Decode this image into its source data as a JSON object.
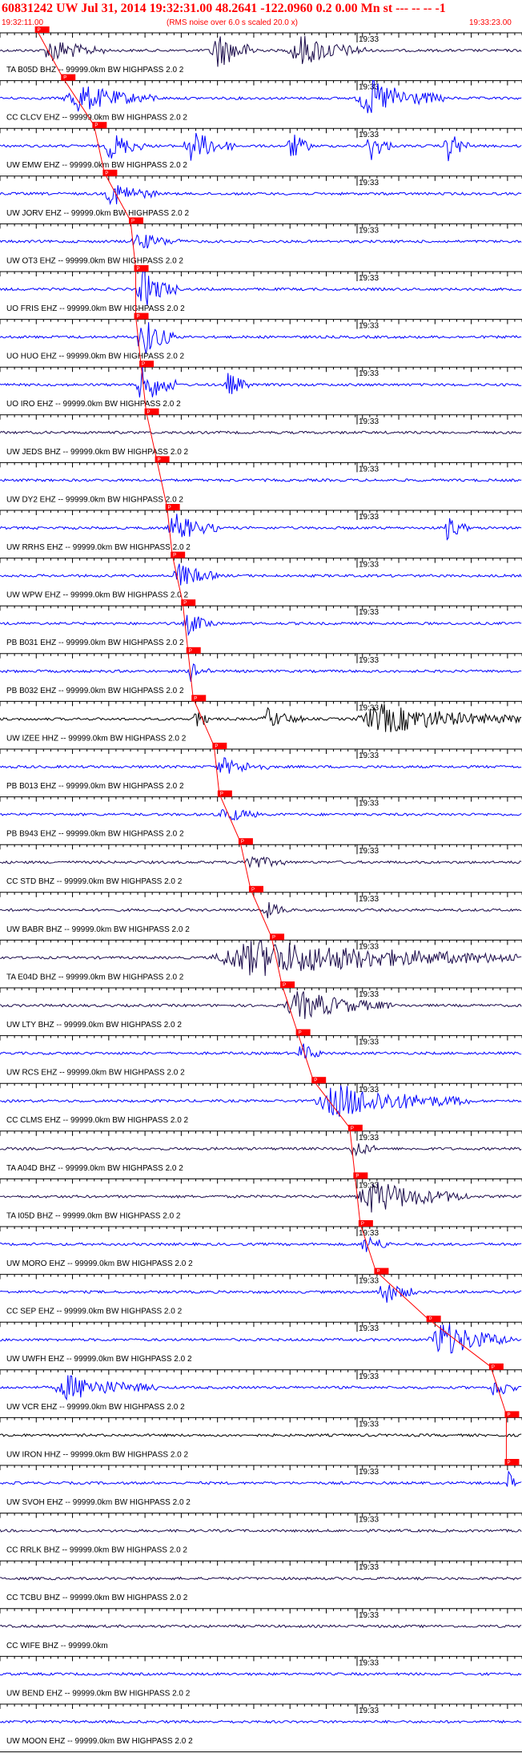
{
  "header": {
    "title": "60831242 UW Jul 31, 2014 19:32:31.00   48.2641 -122.0960  0.2 0.00 Mn st --- -- --   -1",
    "start_time": "19:32:11.00",
    "note": "(RMS noise over 6.0 s scaled 20.0 x)",
    "end_time": "19:33:23.00"
  },
  "time_mark_label": "19:33",
  "colors": {
    "header_text": "#ff0000",
    "blue_trace": "#0000ff",
    "dark_trace": "#1a0a4a",
    "black_trace": "#000000",
    "pick_box": "#ff0000",
    "pick_line": "#ff0000"
  },
  "chart_data": {
    "type": "line",
    "title": "60831242 UW Jul 31, 2014 19:32:31.00",
    "x_range": [
      "19:32:11.00",
      "19:33:23.00"
    ],
    "x_major_label": "19:33",
    "traces": [
      {
        "label": "TA B05D BHZ -- 99999.0km BW  HIGHPASS  2.0  2",
        "color": "#1a0a4a",
        "pick": 0.07,
        "activity": [
          [
            0.08,
            0.2,
            0.6
          ],
          [
            0.4,
            0.5,
            0.9
          ],
          [
            0.55,
            0.7,
            0.8
          ]
        ]
      },
      {
        "label": "CC CLCV EHZ -- 99999.0km BW  HIGHPASS  2.0  2",
        "color": "#0000ff",
        "pick": 0.12,
        "activity": [
          [
            0.12,
            0.3,
            0.7
          ],
          [
            0.68,
            0.85,
            0.9
          ]
        ]
      },
      {
        "label": "UW EMW EHZ -- 99999.0km BW  HIGHPASS  2.0  2",
        "color": "#0000ff",
        "pick": 0.18,
        "activity": [
          [
            0.2,
            0.28,
            0.7
          ],
          [
            0.35,
            0.45,
            0.8
          ],
          [
            0.55,
            0.6,
            0.7
          ],
          [
            0.7,
            0.75,
            0.8
          ],
          [
            0.85,
            0.9,
            0.8
          ]
        ]
      },
      {
        "label": "UW JORV EHZ -- 99999.0km BW  HIGHPASS  2.0  2",
        "color": "#0000ff",
        "pick": 0.2,
        "activity": [
          [
            0.2,
            0.3,
            0.6
          ]
        ]
      },
      {
        "label": "UW OT3 EHZ -- 99999.0km BW  HIGHPASS  2.0  2",
        "color": "#0000ff",
        "pick": 0.25,
        "activity": [
          [
            0.25,
            0.35,
            0.4
          ]
        ]
      },
      {
        "label": "UO FRIS EHZ -- 99999.0km BW  HIGHPASS  2.0  2",
        "color": "#0000ff",
        "pick": 0.26,
        "activity": [
          [
            0.26,
            0.34,
            1.0
          ]
        ]
      },
      {
        "label": "UO HUO EHZ -- 99999.0km BW  HIGHPASS  2.0  2",
        "color": "#0000ff",
        "pick": 0.26,
        "activity": [
          [
            0.26,
            0.34,
            1.0
          ]
        ]
      },
      {
        "label": "UO IRO EHZ -- 99999.0km BW  HIGHPASS  2.0  2",
        "color": "#0000ff",
        "pick": 0.27,
        "activity": [
          [
            0.26,
            0.34,
            1.0
          ],
          [
            0.43,
            0.48,
            0.6
          ]
        ]
      },
      {
        "label": "UW JEDS BHZ -- 99999.0km BW  HIGHPASS  2.0  2",
        "color": "#1a0a4a",
        "pick": 0.28,
        "activity": []
      },
      {
        "label": "UW DY2 EHZ -- 99999.0km BW  HIGHPASS  2.0  2",
        "color": "#0000ff",
        "pick": 0.3,
        "activity": []
      },
      {
        "label": "UW RRHS EHZ -- 99999.0km BW  HIGHPASS  2.0  2",
        "color": "#0000ff",
        "pick": 0.32,
        "activity": [
          [
            0.32,
            0.42,
            0.7
          ],
          [
            0.85,
            0.9,
            0.6
          ]
        ]
      },
      {
        "label": "UW WPW EHZ -- 99999.0km BW  HIGHPASS  2.0  2",
        "color": "#0000ff",
        "pick": 0.33,
        "activity": [
          [
            0.33,
            0.42,
            0.6
          ]
        ]
      },
      {
        "label": "PB B031 EHZ -- 99999.0km BW  HIGHPASS  2.0  2",
        "color": "#0000ff",
        "pick": 0.35,
        "activity": [
          [
            0.35,
            0.42,
            0.5
          ]
        ]
      },
      {
        "label": "PB B032 EHZ -- 99999.0km BW  HIGHPASS  2.0  2",
        "color": "#0000ff",
        "pick": 0.36,
        "activity": [
          [
            0.36,
            0.4,
            0.5
          ]
        ]
      },
      {
        "label": "UW IZEE HHZ -- 99999.0km BW  HIGHPASS  2.0  2",
        "color": "#000000",
        "pick": 0.37,
        "activity": [
          [
            0.37,
            0.4,
            0.7
          ],
          [
            0.5,
            0.58,
            0.5
          ],
          [
            0.68,
            1.0,
            0.7
          ]
        ]
      },
      {
        "label": "PB B013 EHZ -- 99999.0km BW  HIGHPASS  2.0  2",
        "color": "#0000ff",
        "pick": 0.41,
        "activity": [
          [
            0.41,
            0.52,
            0.4
          ]
        ]
      },
      {
        "label": "PB B943 EHZ -- 99999.0km BW  HIGHPASS  2.0  2",
        "color": "#0000ff",
        "pick": 0.42,
        "activity": [
          [
            0.42,
            0.5,
            0.4
          ]
        ]
      },
      {
        "label": "CC STD BHZ -- 99999.0km BW  HIGHPASS  2.0  2",
        "color": "#1a0a4a",
        "pick": 0.46,
        "activity": [
          [
            0.46,
            0.55,
            0.4
          ]
        ]
      },
      {
        "label": "UW BABR BHZ -- 99999.0km BW  HIGHPASS  2.0  2",
        "color": "#1a0a4a",
        "pick": 0.48,
        "activity": [
          [
            0.5,
            0.56,
            0.4
          ]
        ]
      },
      {
        "label": "TA E04D BHZ -- 99999.0km BW  HIGHPASS  2.0  2",
        "color": "#1a0a4a",
        "pick": 0.52,
        "activity": [
          [
            0.4,
            1.0,
            0.9
          ]
        ]
      },
      {
        "label": "UW LTY BHZ -- 99999.0km BW  HIGHPASS  2.0  2",
        "color": "#1a0a4a",
        "pick": 0.54,
        "activity": [
          [
            0.54,
            0.75,
            0.7
          ]
        ]
      },
      {
        "label": "UW RCS EHZ -- 99999.0km BW  HIGHPASS  2.0  2",
        "color": "#0000ff",
        "pick": 0.57,
        "activity": [
          [
            0.57,
            0.62,
            0.5
          ]
        ]
      },
      {
        "label": "CC CLMS EHZ -- 99999.0km BW  HIGHPASS  2.0  2",
        "color": "#0000ff",
        "pick": 0.6,
        "activity": [
          [
            0.6,
            0.9,
            0.8
          ]
        ]
      },
      {
        "label": "TA A04D BHZ -- 99999.0km BW  HIGHPASS  2.0  2",
        "color": "#1a0a4a",
        "pick": 0.67,
        "activity": [
          [
            0.67,
            0.72,
            0.5
          ]
        ]
      },
      {
        "label": "TA I05D BHZ -- 99999.0km BW  HIGHPASS  2.0  2",
        "color": "#1a0a4a",
        "pick": 0.68,
        "activity": [
          [
            0.68,
            0.9,
            0.8
          ]
        ]
      },
      {
        "label": "UW MORO EHZ -- 99999.0km BW  HIGHPASS  2.0  2",
        "color": "#0000ff",
        "pick": 0.69,
        "activity": [
          [
            0.69,
            0.75,
            0.5
          ]
        ]
      },
      {
        "label": "CC SEP EHZ -- 99999.0km BW  HIGHPASS  2.0  2",
        "color": "#0000ff",
        "pick": 0.72,
        "activity": [
          [
            0.72,
            0.8,
            0.6
          ]
        ]
      },
      {
        "label": "UW UWFH EHZ -- 99999.0km BW  HIGHPASS  2.0  2",
        "color": "#0000ff",
        "pick": 0.82,
        "activity": [
          [
            0.82,
            0.98,
            0.9
          ]
        ]
      },
      {
        "label": "UW VCR EHZ -- 99999.0km BW  HIGHPASS  2.0  2",
        "color": "#0000ff",
        "pick": 0.94,
        "activity": [
          [
            0.1,
            0.3,
            0.6
          ],
          [
            0.94,
            0.99,
            0.6
          ]
        ]
      },
      {
        "label": "UW IRON HHZ -- 99999.0km BW  HIGHPASS  2.0  2",
        "color": "#000000",
        "pick": 0.97,
        "activity": []
      },
      {
        "label": "UW SVOH EHZ -- 99999.0km BW  HIGHPASS  2.0  2",
        "color": "#0000ff",
        "pick": 0.97,
        "activity": [
          [
            0.97,
            0.99,
            0.6
          ]
        ]
      },
      {
        "label": "CC RRLK BHZ -- 99999.0km BW  HIGHPASS  2.0  2",
        "color": "#1a0a4a",
        "pick": null,
        "activity": []
      },
      {
        "label": "CC TCBU BHZ -- 99999.0km BW  HIGHPASS  2.0  2",
        "color": "#1a0a4a",
        "pick": null,
        "activity": []
      },
      {
        "label": "CC WIFE BHZ -- 99999.0km",
        "color": "#1a0a4a",
        "pick": null,
        "activity": []
      },
      {
        "label": "UW BEND EHZ -- 99999.0km BW  HIGHPASS  2.0  2",
        "color": "#0000ff",
        "pick": null,
        "activity": []
      },
      {
        "label": "UW MOON EHZ -- 99999.0km BW  HIGHPASS  2.0  2",
        "color": "#0000ff",
        "pick": null,
        "activity": []
      }
    ]
  }
}
